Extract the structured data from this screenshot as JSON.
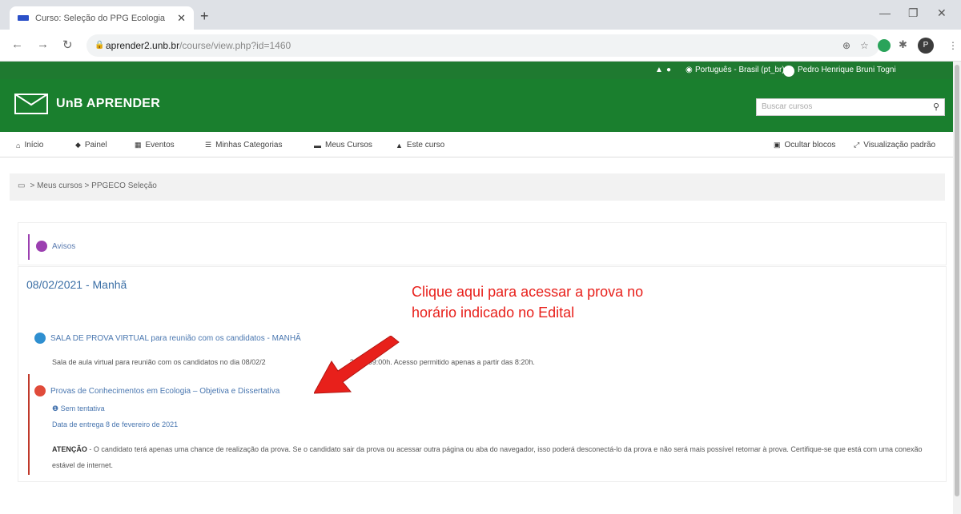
{
  "browser": {
    "tab_title": "Curso: Seleção do PPG Ecologia",
    "url_host": "aprender2.unb.br",
    "url_path": "/course/view.php?id=1460",
    "avatar_letter": "P"
  },
  "topbar": {
    "language": "Português - Brasil (pt_br)",
    "user": "Pedro Henrique Bruni Togni"
  },
  "header": {
    "brand": "UnB APRENDER",
    "search_placeholder": "Buscar cursos"
  },
  "menu": {
    "items": [
      "Início",
      "Painel",
      "Eventos",
      "Minhas Categorias",
      "Meus Cursos",
      "Este curso"
    ],
    "right": [
      "Ocultar blocos",
      "Visualização padrão"
    ]
  },
  "breadcrumb": "> Meus cursos > PPGECO Seleção",
  "avisos": "Avisos",
  "section": {
    "title": "08/02/2021 - Manhã",
    "activity1": "SALA DE PROVA VIRTUAL para reunião com os candidatos - MANHÃ",
    "activity1_desc_a": "Sala de aula virtual para reunião com os candidatos no dia 08/02/2",
    "activity1_desc_b": "20h - 09:00h. Acesso permitido apenas a partir das 8:20h.",
    "activity2": "Provas de Conhecimentos em Ecologia – Objetiva e Dissertativa",
    "attempts": "Sem tentativa",
    "due": "Data de entrega 8 de fevereiro de 2021",
    "warning_label": "ATENÇÃO",
    "warning_text": " - O candidato terá apenas uma chance de realização da prova. Se o candidato sair da prova ou acessar outra página ou aba do navegador, isso poderá desconectá-lo da prova e não será mais possível retornar à prova. Certifique-se que está com uma conexão estável de internet."
  },
  "callout": "Clique aqui para acessar a prova no horário indicado no Edital",
  "colors": {
    "green": "#1a7f2e",
    "callout": "#e8201b",
    "link": "#4a77b0"
  }
}
